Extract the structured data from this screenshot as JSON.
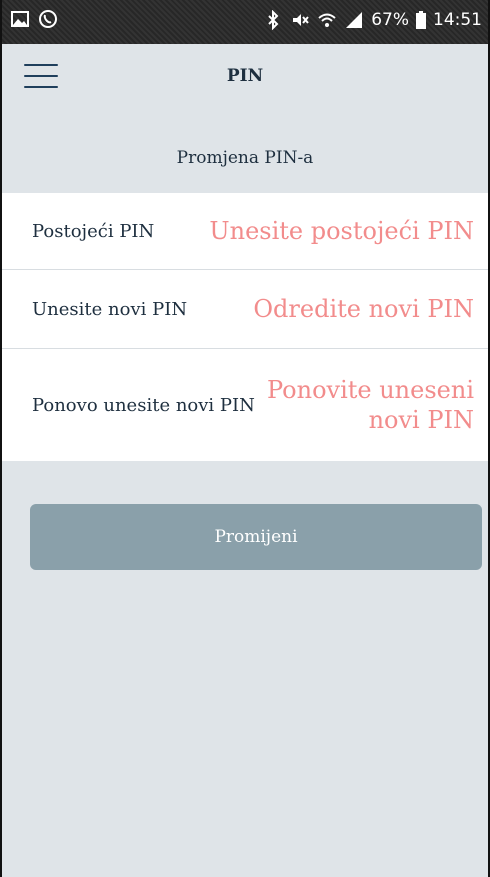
{
  "status_bar": {
    "battery": "67%",
    "time": "14:51",
    "icons": [
      "gallery-icon",
      "viber-icon",
      "bluetooth-icon",
      "mute-icon",
      "wifi-icon",
      "signal-icon",
      "battery-icon"
    ]
  },
  "app_bar": {
    "title": "PIN",
    "menu_icon": "hamburger-menu-icon"
  },
  "section_title": "Promjena PIN-a",
  "form": {
    "fields": [
      {
        "label": "Postojeći PIN",
        "placeholder": "Unesite postojeći PIN"
      },
      {
        "label": "Unesite novi PIN",
        "placeholder": "Odredite novi PIN"
      },
      {
        "label": "Ponovo unesite novi PIN",
        "placeholder": "Ponovite uneseni novi PIN"
      }
    ]
  },
  "submit_label": "Promijeni",
  "colors": {
    "background": "#dfe4e8",
    "placeholder": "#f28c8c",
    "button": "#8aa0aa",
    "text": "#1e2f3f"
  }
}
